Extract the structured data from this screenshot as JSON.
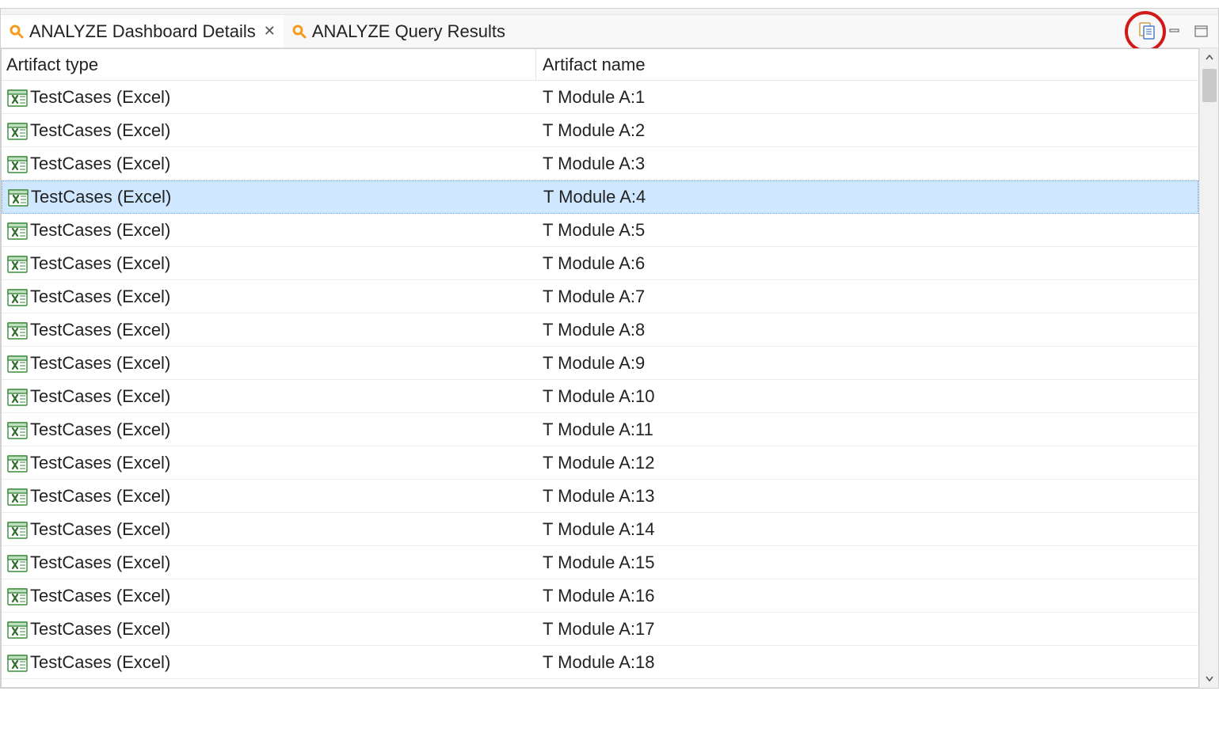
{
  "tabs": [
    {
      "label": "ANALYZE Dashboard Details",
      "active": true,
      "closable": true
    },
    {
      "label": "ANALYZE Query Results",
      "active": false,
      "closable": false
    }
  ],
  "columns": {
    "type": "Artifact type",
    "name": "Artifact name"
  },
  "selected_index": 3,
  "rows": [
    {
      "type": "TestCases (Excel)",
      "name": "T Module A:1"
    },
    {
      "type": "TestCases (Excel)",
      "name": "T Module A:2"
    },
    {
      "type": "TestCases (Excel)",
      "name": "T Module A:3"
    },
    {
      "type": "TestCases (Excel)",
      "name": "T Module A:4"
    },
    {
      "type": "TestCases (Excel)",
      "name": "T Module A:5"
    },
    {
      "type": "TestCases (Excel)",
      "name": "T Module A:6"
    },
    {
      "type": "TestCases (Excel)",
      "name": "T Module A:7"
    },
    {
      "type": "TestCases (Excel)",
      "name": "T Module A:8"
    },
    {
      "type": "TestCases (Excel)",
      "name": "T Module A:9"
    },
    {
      "type": "TestCases (Excel)",
      "name": "T Module A:10"
    },
    {
      "type": "TestCases (Excel)",
      "name": "T Module A:11"
    },
    {
      "type": "TestCases (Excel)",
      "name": "T Module A:12"
    },
    {
      "type": "TestCases (Excel)",
      "name": "T Module A:13"
    },
    {
      "type": "TestCases (Excel)",
      "name": "T Module A:14"
    },
    {
      "type": "TestCases (Excel)",
      "name": "T Module A:15"
    },
    {
      "type": "TestCases (Excel)",
      "name": "T Module A:16"
    },
    {
      "type": "TestCases (Excel)",
      "name": "T Module A:17"
    },
    {
      "type": "TestCases (Excel)",
      "name": "T Module A:18"
    }
  ]
}
